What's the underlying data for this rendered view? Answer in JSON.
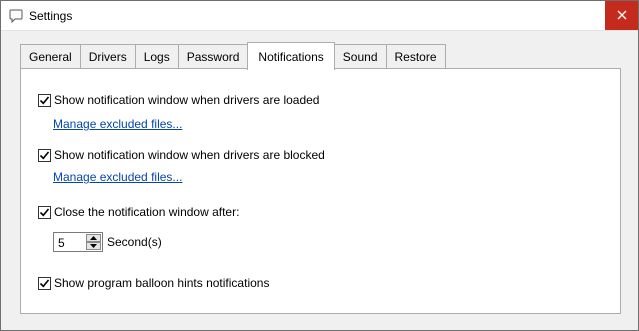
{
  "window": {
    "title": "Settings",
    "close_glyph": "✕",
    "accent_close": "#c42b1c"
  },
  "tabs": [
    {
      "label": "General",
      "active": false
    },
    {
      "label": "Drivers",
      "active": false
    },
    {
      "label": "Logs",
      "active": false
    },
    {
      "label": "Password",
      "active": false
    },
    {
      "label": "Notifications",
      "active": true
    },
    {
      "label": "Sound",
      "active": false
    },
    {
      "label": "Restore",
      "active": false
    }
  ],
  "notifications": {
    "loaded_check": {
      "label": "Show notification window when drivers are loaded",
      "checked": true
    },
    "loaded_link": "Manage excluded files...",
    "blocked_check": {
      "label": "Show notification window when drivers are blocked",
      "checked": true
    },
    "blocked_link": "Manage excluded files...",
    "close_after_check": {
      "label": "Close the notification window after:",
      "checked": true
    },
    "close_after_value": "5",
    "close_after_unit": "Second(s)",
    "balloon_check": {
      "label": "Show program balloon hints notifications",
      "checked": true
    }
  },
  "icons": {
    "app": "chat-bubble-icon",
    "close": "close-icon",
    "checkmark": "checkmark-icon",
    "spin_up": "arrow-up-icon",
    "spin_down": "arrow-down-icon"
  }
}
